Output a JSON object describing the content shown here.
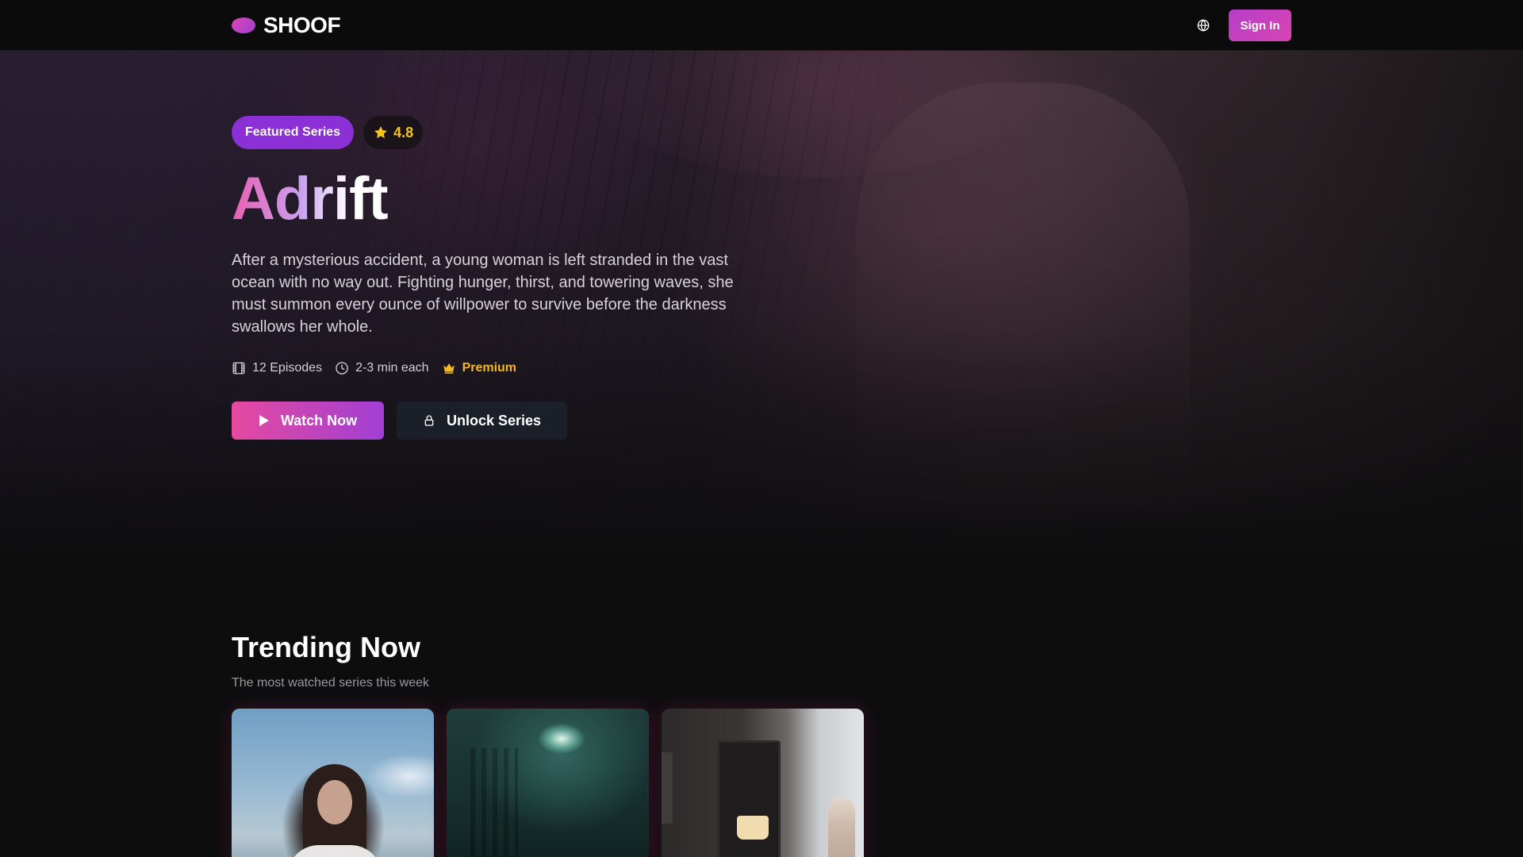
{
  "brand": {
    "name": "SHOOF",
    "accent": "#d844b3"
  },
  "nav": {
    "signin_label": "Sign In",
    "language_icon": "globe-icon"
  },
  "hero": {
    "badge": "Featured Series",
    "rating": "4.8",
    "title": "Adrift",
    "description": "After a mysterious accident, a young woman is left stranded in the vast ocean with no way out. Fighting hunger, thirst, and towering waves, she must summon every ounce of willpower to survive before the darkness swallows her whole.",
    "meta": {
      "episodes": "12 Episodes",
      "duration": "2-3 min each",
      "tier": "Premium"
    },
    "watch_label": "Watch Now",
    "unlock_label": "Unlock Series"
  },
  "trending": {
    "title": "Trending Now",
    "subtitle": "The most watched series this week"
  }
}
